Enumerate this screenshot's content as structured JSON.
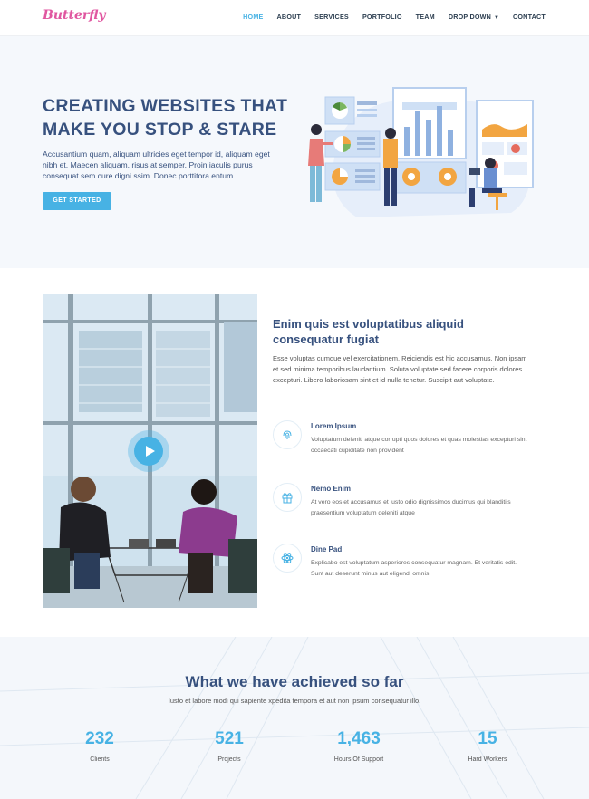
{
  "header": {
    "logo_text": "Butterfly",
    "nav": [
      {
        "label": "HOME",
        "active": true
      },
      {
        "label": "ABOUT"
      },
      {
        "label": "SERVICES"
      },
      {
        "label": "PORTFOLIO"
      },
      {
        "label": "TEAM"
      },
      {
        "label": "DROP DOWN",
        "has_caret": true
      },
      {
        "label": "CONTACT"
      }
    ]
  },
  "hero": {
    "title": "CREATING WEBSITES THAT MAKE YOU STOP & STARE",
    "text": "Accusantium quam, aliquam ultricies eget tempor id, aliquam eget nibh et. Maecen aliquam, risus at semper. Proin iaculis purus consequat sem cure digni ssim. Donec porttitora entum.",
    "button_label": "GET STARTED"
  },
  "about": {
    "title": "Enim quis est voluptatibus aliquid consequatur fugiat",
    "text": "Esse voluptas cumque vel exercitationem. Reiciendis est hic accusamus. Non ipsam et sed minima temporibus laudantium. Soluta voluptate sed facere corporis dolores excepturi. Libero laboriosam sint et id nulla tenetur. Suscipit aut voluptate.",
    "features": [
      {
        "icon": "fingerprint-icon",
        "title": "Lorem Ipsum",
        "desc": "Voluptatum deleniti atque corrupti quos dolores et quas molestias excepturi sint occaecati cupiditate non provident"
      },
      {
        "icon": "gift-icon",
        "title": "Nemo Enim",
        "desc": "At vero eos et accusamus et iusto odio dignissimos ducimus qui blanditiis praesentium voluptatum deleniti atque"
      },
      {
        "icon": "atom-icon",
        "title": "Dine Pad",
        "desc": "Explicabo est voluptatum asperiores consequatur magnam. Et veritatis odit. Sunt aut deserunt minus aut eligendi omnis"
      }
    ]
  },
  "stats": {
    "title": "What we have achieved so far",
    "subtitle": "Iusto et labore modi qui sapiente xpedita tempora et aut non ipsum consequatur illo.",
    "items": [
      {
        "value": "232",
        "label": "Clients"
      },
      {
        "value": "521",
        "label": "Projects"
      },
      {
        "value": "1,463",
        "label": "Hours Of Support"
      },
      {
        "value": "15",
        "label": "Hard Workers"
      }
    ]
  },
  "colors": {
    "accent": "#47b2e4",
    "heading": "#37517e",
    "logo": "#6c5ce7",
    "logo_alt": "#e056a0"
  }
}
